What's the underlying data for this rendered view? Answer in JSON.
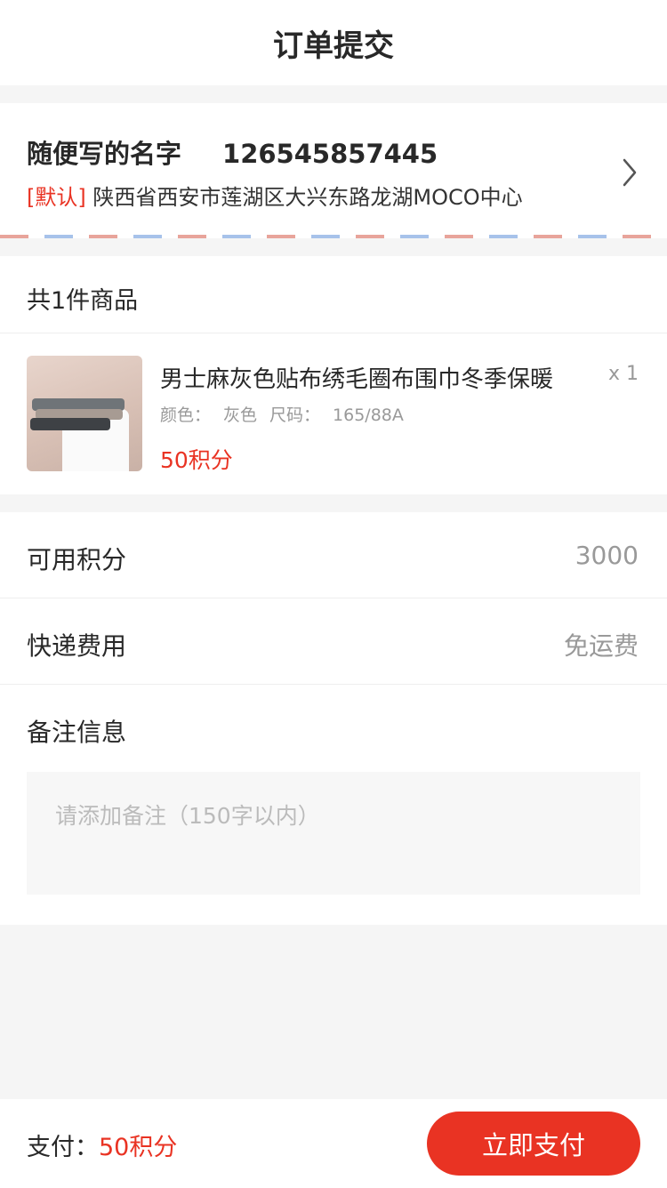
{
  "header": {
    "title": "订单提交"
  },
  "address": {
    "name": "随便写的名字",
    "phone": "126545857445",
    "default_tag": "[默认]",
    "detail": "陕西省西安市莲湖区大兴东路龙湖MOCO中心"
  },
  "goods": {
    "count_title": "共1件商品",
    "items": [
      {
        "name": "男士麻灰色贴布绣毛圈布围巾冬季保暖",
        "color_label": "颜色：",
        "color": "灰色",
        "size_label": "尺码：",
        "size": "165/88A",
        "price": "50积分",
        "quantity": "x 1"
      }
    ]
  },
  "info": {
    "points_label": "可用积分",
    "points_value": "3000",
    "shipping_label": "快递费用",
    "shipping_value": "免运费",
    "remark_label": "备注信息",
    "remark_placeholder": "请添加备注（150字以内）"
  },
  "footer": {
    "pay_label": "支付：",
    "pay_amount": "50积分",
    "pay_button": "立即支付"
  },
  "colors": {
    "accent": "#e93323",
    "text_primary": "#282828",
    "text_secondary": "#999999",
    "background": "#f5f5f5"
  }
}
